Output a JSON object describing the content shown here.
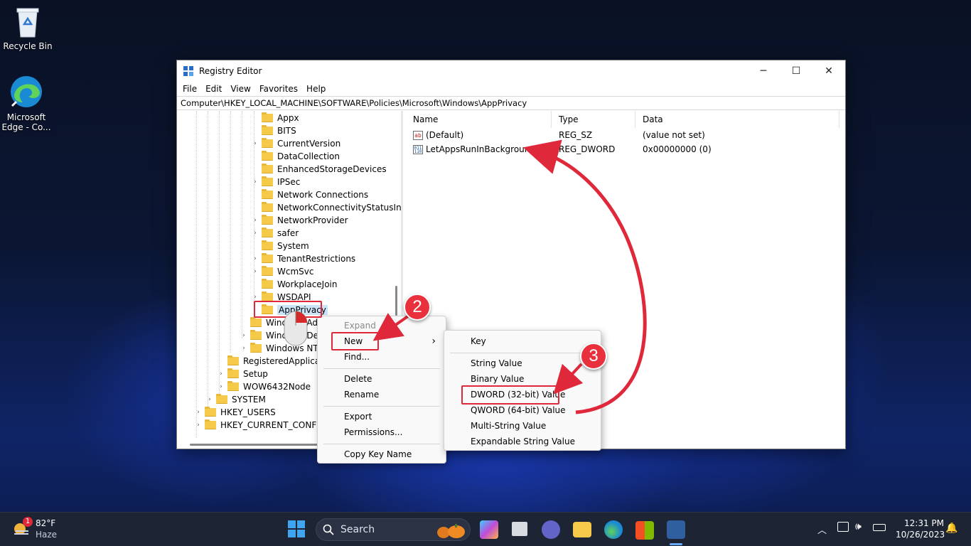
{
  "desktop": {
    "icons": [
      {
        "label": "Recycle Bin"
      },
      {
        "label": "Microsoft Edge - Co..."
      }
    ]
  },
  "window": {
    "title": "Registry Editor",
    "controls": {
      "minimize": "─",
      "maximize": "☐",
      "close": "✕"
    },
    "menu": [
      "File",
      "Edit",
      "View",
      "Favorites",
      "Help"
    ],
    "address": "Computer\\HKEY_LOCAL_MACHINE\\SOFTWARE\\Policies\\Microsoft\\Windows\\AppPrivacy"
  },
  "tree": {
    "items": [
      {
        "label": "Appx",
        "expandable": false
      },
      {
        "label": "BITS",
        "expandable": false
      },
      {
        "label": "CurrentVersion",
        "expandable": true
      },
      {
        "label": "DataCollection",
        "expandable": false
      },
      {
        "label": "EnhancedStorageDevices",
        "expandable": false
      },
      {
        "label": "IPSec",
        "expandable": true
      },
      {
        "label": "Network Connections",
        "expandable": false
      },
      {
        "label": "NetworkConnectivityStatusIndi",
        "expandable": false
      },
      {
        "label": "NetworkProvider",
        "expandable": true
      },
      {
        "label": "safer",
        "expandable": true
      },
      {
        "label": "System",
        "expandable": false
      },
      {
        "label": "TenantRestrictions",
        "expandable": true
      },
      {
        "label": "WcmSvc",
        "expandable": true
      },
      {
        "label": "WorkplaceJoin",
        "expandable": false
      },
      {
        "label": "WSDAPI",
        "expandable": true
      },
      {
        "label": "AppPrivacy",
        "expandable": false,
        "selected": true
      },
      {
        "label": "Windows Adva",
        "expandable": false
      },
      {
        "label": "Windows Defe",
        "expandable": true
      },
      {
        "label": "Windows NT",
        "expandable": true
      },
      {
        "label": "RegisteredApplications",
        "expandable": false
      },
      {
        "label": "Setup",
        "expandable": true
      },
      {
        "label": "WOW6432Node",
        "expandable": true
      },
      {
        "label": "SYSTEM",
        "expandable": true
      },
      {
        "label": "HKEY_USERS",
        "expandable": true
      },
      {
        "label": "HKEY_CURRENT_CONFIG",
        "expandable": true
      }
    ]
  },
  "list": {
    "columns": [
      "Name",
      "Type",
      "Data"
    ],
    "rows": [
      {
        "name": "(Default)",
        "type": "REG_SZ",
        "data": "(value not set)",
        "icon": "string-value-icon",
        "glyph": "ab"
      },
      {
        "name": "LetAppsRunInBackground",
        "type": "REG_DWORD",
        "data": "0x00000000 (0)",
        "icon": "binary-value-icon",
        "glyph": "011\n110"
      }
    ]
  },
  "context_menu": {
    "items": [
      "Expand",
      "New",
      "Find...",
      "Delete",
      "Rename",
      "Export",
      "Permissions...",
      "Copy Key Name"
    ],
    "submenu_arrow": "›"
  },
  "submenu": {
    "items": [
      "Key",
      "String Value",
      "Binary Value",
      "DWORD (32-bit) Value",
      "QWORD (64-bit) Value",
      "Multi-String Value",
      "Expandable String Value"
    ]
  },
  "annotations": {
    "step2": "2",
    "step3": "3",
    "accent": "#e0283b"
  },
  "taskbar": {
    "weather": {
      "temp": "82°F",
      "condition": "Haze",
      "badge": "1"
    },
    "search_placeholder": "Search",
    "time": "12:31 PM",
    "date": "10/26/2023",
    "pinned": [
      "start-icon",
      "copilot-icon",
      "task-view-icon",
      "teams-icon",
      "file-explorer-icon",
      "edge-icon",
      "store-icon",
      "regedit-icon"
    ]
  }
}
